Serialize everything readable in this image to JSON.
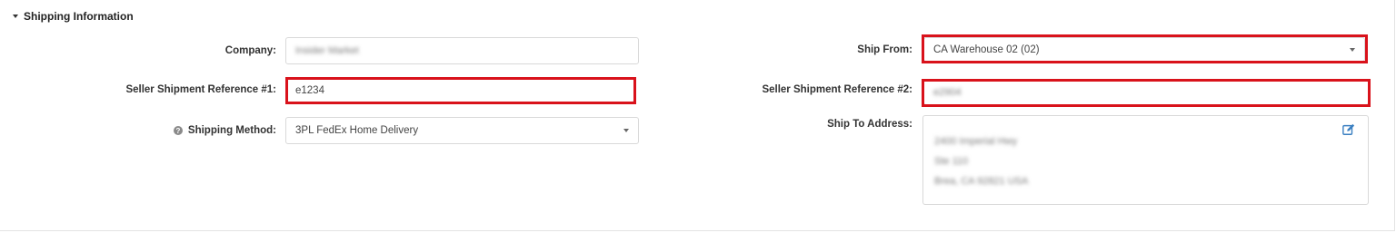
{
  "section": {
    "title": "Shipping Information"
  },
  "left": {
    "company": {
      "label": "Company:",
      "value": "Insider Market"
    },
    "ref1": {
      "label": "Seller Shipment Reference #1:",
      "value": "e1234"
    },
    "shipping_method": {
      "label": "Shipping Method:",
      "value": "3PL FedEx Home Delivery"
    }
  },
  "right": {
    "ship_from": {
      "label": "Ship From:",
      "value": "CA Warehouse 02 (02)"
    },
    "ref2": {
      "label": "Seller Shipment Reference #2:",
      "value": "e2904"
    },
    "ship_to": {
      "label": "Ship To Address:",
      "lines": [
        "2400 Imperial Hwy",
        "Ste 110",
        "Brea, CA 92821 USA"
      ]
    }
  },
  "colors": {
    "highlight": "#d9121b",
    "icon_blue": "#3a7fc1"
  },
  "icons": {
    "collapse": "caret-down-icon",
    "help": "question-circle-icon",
    "edit": "edit-icon",
    "dropdown": "chevron-down-icon"
  }
}
